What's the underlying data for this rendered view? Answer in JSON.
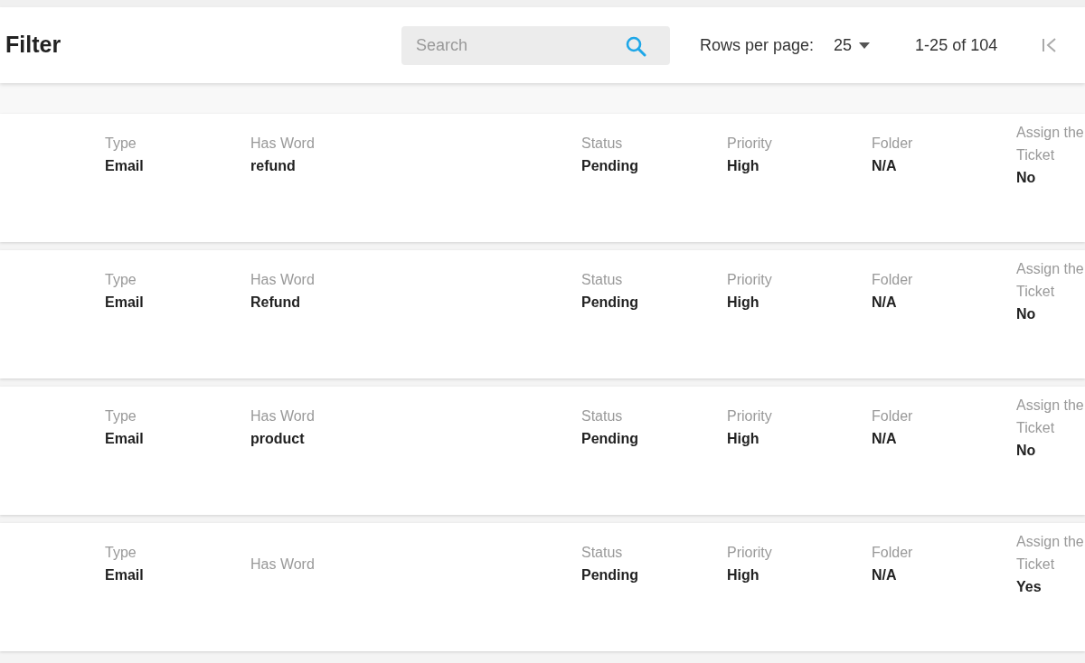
{
  "header": {
    "title": "Filter",
    "search": {
      "placeholder": "Search"
    },
    "rows_per_page": {
      "label": "Rows per page:",
      "value": "25"
    },
    "range": "1-25 of 104"
  },
  "rows": [
    {
      "fields": [
        {
          "label": "Type",
          "value": "Email"
        },
        {
          "label": "Has Word",
          "value": "refund"
        },
        {
          "label": "Status",
          "value": "Pending"
        },
        {
          "label": "Priority",
          "value": "High"
        },
        {
          "label": "Folder",
          "value": "N/A"
        },
        {
          "label": "Assign the Ticket",
          "value": "No"
        }
      ]
    },
    {
      "fields": [
        {
          "label": "Type",
          "value": "Email"
        },
        {
          "label": "Has Word",
          "value": "Refund"
        },
        {
          "label": "Status",
          "value": "Pending"
        },
        {
          "label": "Priority",
          "value": "High"
        },
        {
          "label": "Folder",
          "value": "N/A"
        },
        {
          "label": "Assign the Ticket",
          "value": "No"
        }
      ]
    },
    {
      "fields": [
        {
          "label": "Type",
          "value": "Email"
        },
        {
          "label": "Has Word",
          "value": "product"
        },
        {
          "label": "Status",
          "value": "Pending"
        },
        {
          "label": "Priority",
          "value": "High"
        },
        {
          "label": "Folder",
          "value": "N/A"
        },
        {
          "label": "Assign the Ticket",
          "value": "No"
        }
      ]
    },
    {
      "fields": [
        {
          "label": "Type",
          "value": "Email"
        },
        {
          "label": "Has Word"
        },
        {
          "label": "Status",
          "value": "Pending"
        },
        {
          "label": "Priority",
          "value": "High"
        },
        {
          "label": "Folder",
          "value": "N/A"
        },
        {
          "label": "Assign the Ticket",
          "value": "Yes"
        }
      ]
    }
  ]
}
